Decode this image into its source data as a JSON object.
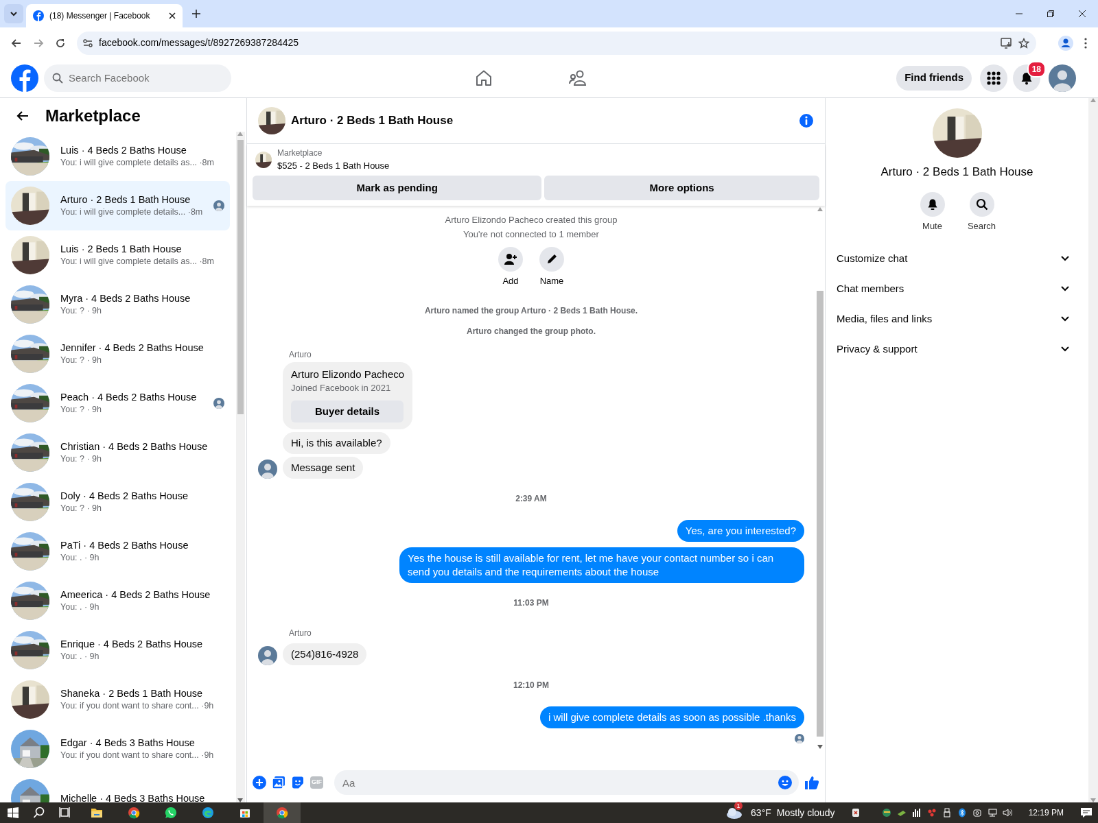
{
  "browser": {
    "tab_title": "(18) Messenger | Facebook",
    "url": "facebook.com/messages/t/8927269387284425"
  },
  "header": {
    "search_placeholder": "Search Facebook",
    "find_friends": "Find friends",
    "notification_count": "18"
  },
  "sidebar": {
    "title": "Marketplace",
    "conversations": [
      {
        "title": "Luis · 4 Beds 2 Baths House",
        "preview": "You: i will give complete details as... ·8m",
        "selected": false,
        "seen": false
      },
      {
        "title": "Arturo · 2 Beds 1 Bath House",
        "preview": "You: i will give complete details... ·8m",
        "selected": true,
        "seen": true
      },
      {
        "title": "Luis · 2 Beds 1 Bath House",
        "preview": "You: i will give complete details as... ·8m",
        "selected": false,
        "seen": false
      },
      {
        "title": "Myra · 4 Beds 2 Baths House",
        "preview": "You: ? · 9h",
        "selected": false,
        "seen": false
      },
      {
        "title": "Jennifer · 4 Beds 2 Baths House",
        "preview": "You: ? · 9h",
        "selected": false,
        "seen": false
      },
      {
        "title": "Peach · 4 Beds 2 Baths House",
        "preview": "You: ? · 9h",
        "selected": false,
        "seen": true
      },
      {
        "title": "Christian · 4 Beds 2 Baths House",
        "preview": "You: ? · 9h",
        "selected": false,
        "seen": false
      },
      {
        "title": "Doly · 4 Beds 2 Baths House",
        "preview": "You: ? · 9h",
        "selected": false,
        "seen": false
      },
      {
        "title": "PaTi · 4 Beds 2 Baths House",
        "preview": "You: . · 9h",
        "selected": false,
        "seen": false
      },
      {
        "title": "Ameerica · 4 Beds 2 Baths House",
        "preview": "You: . · 9h",
        "selected": false,
        "seen": false
      },
      {
        "title": "Enrique · 4 Beds 2 Baths House",
        "preview": "You: . · 9h",
        "selected": false,
        "seen": false
      },
      {
        "title": "Shaneka · 2 Beds 1 Bath House",
        "preview": "You: if you dont want to share cont... ·9h",
        "selected": false,
        "seen": false
      },
      {
        "title": "Edgar · 4 Beds 3 Baths House",
        "preview": "You: if you dont want to share cont... ·9h",
        "selected": false,
        "seen": false
      },
      {
        "title": "Michelle · 4 Beds 3 Baths House",
        "selected": false,
        "seen": false
      }
    ]
  },
  "chat": {
    "title": "Arturo · 2 Beds 1 Bath House",
    "listing": {
      "label": "Marketplace",
      "title": "$525 - 2 Beds 1 Bath House"
    },
    "actions": [
      "Mark as pending",
      "More options"
    ],
    "messages": [
      {
        "kind": "notice",
        "text": "Arturo Elizondo Pacheco created this group"
      },
      {
        "kind": "notice",
        "text": "You're not connected to 1 member"
      },
      {
        "kind": "actions",
        "items": [
          "Add",
          "Name"
        ]
      },
      {
        "kind": "event",
        "text": "Arturo named the group Arturo · 2 Beds 1 Bath House."
      },
      {
        "kind": "event",
        "text": "Arturo changed the group photo."
      },
      {
        "kind": "sender",
        "text": "Arturo"
      },
      {
        "kind": "profile",
        "name": "Arturo Elizondo Pacheco",
        "subtitle": "Joined Facebook in 2021",
        "button": "Buyer details"
      },
      {
        "kind": "incoming",
        "text": "Hi, is this available?",
        "avatar": false
      },
      {
        "kind": "incoming",
        "text": "Message sent",
        "avatar": true
      },
      {
        "kind": "time",
        "text": "2:39 AM"
      },
      {
        "kind": "outgoing",
        "text": "Yes, are you interested?"
      },
      {
        "kind": "outgoing",
        "text": "Yes the house is still available for rent, let me have your contact number so i can send you details and the requirements about the house"
      },
      {
        "kind": "time",
        "text": "11:03 PM"
      },
      {
        "kind": "sender",
        "text": "Arturo"
      },
      {
        "kind": "incoming",
        "text": "(254)816-4928",
        "avatar": true
      },
      {
        "kind": "time",
        "text": "12:10 PM"
      },
      {
        "kind": "outgoing",
        "text": "i will give complete details as soon as possible .thanks"
      }
    ],
    "seen_by_recipient": true,
    "composer": {
      "gif_label": "GIF",
      "placeholder": "Aa"
    }
  },
  "details": {
    "title": "Arturo · 2 Beds 1 Bath House",
    "buttons": [
      "Mute",
      "Search"
    ],
    "sections": [
      {
        "label": "Customize chat",
        "expanded": false
      },
      {
        "label": "Chat members",
        "expanded": false
      },
      {
        "label": "Media, files and links",
        "expanded": false
      },
      {
        "label": "Privacy & support",
        "expanded": false
      }
    ]
  },
  "taskbar": {
    "weather_badge": "1",
    "temperature": "63°F",
    "weather": "Mostly cloudy",
    "time": "12:19 PM"
  }
}
